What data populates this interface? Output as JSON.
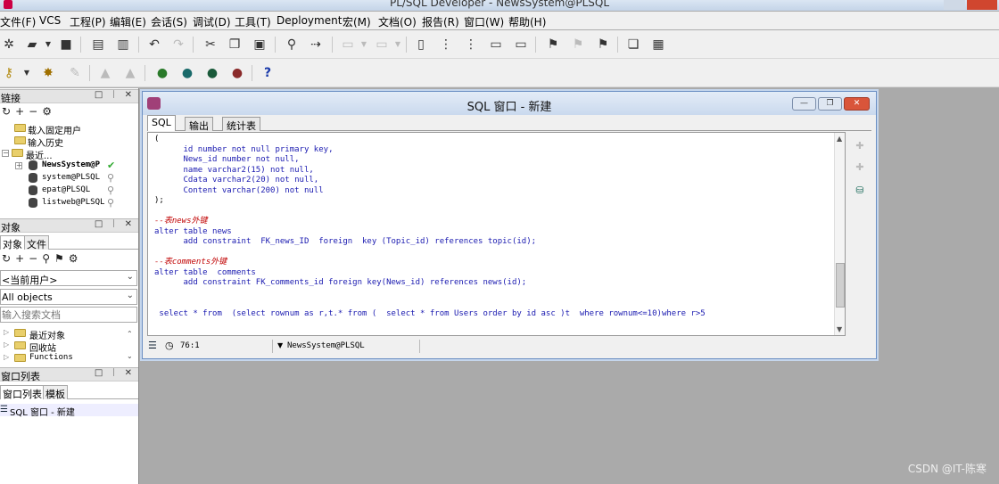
{
  "app": {
    "title": "PL/SQL Developer - NewsSystem@PLSQL"
  },
  "menu": [
    "文件(F)",
    "VCS",
    "工程(P)",
    "编辑(E)",
    "会话(S)",
    "调试(D)",
    "工具(T)",
    "Deployment",
    "宏(M)",
    "文档(O)",
    "报告(R)",
    "窗口(W)",
    "帮助(H)"
  ],
  "left": {
    "connections": {
      "title": "链接",
      "controls": "□ ᛁ ✕",
      "items": [
        {
          "label": "载入固定用户"
        },
        {
          "label": "输入历史"
        },
        {
          "label": "最近..."
        },
        {
          "label": "NewsSystem@P"
        },
        {
          "label": "system@PLSQL"
        },
        {
          "label": "epat@PLSQL"
        },
        {
          "label": "listweb@PLSQL"
        }
      ]
    },
    "objects": {
      "title": "对象",
      "controls": "□ ᛁ ✕",
      "tabs": [
        "对象",
        "文件"
      ],
      "owner": "<当前用户>",
      "filter": "All objects",
      "search_placeholder": "输入搜索文档",
      "items": [
        {
          "label": "最近对象"
        },
        {
          "label": "回收站"
        },
        {
          "label": "Functions"
        }
      ]
    },
    "windows": {
      "title": "窗口列表",
      "controls": "□ ᛁ ✕",
      "tabs": [
        "窗口列表",
        "模板"
      ],
      "items": [
        {
          "label": "SQL 窗口 - 新建"
        }
      ]
    }
  },
  "sql_window": {
    "title": "SQL 窗口 - 新建",
    "tabs": [
      "SQL",
      "输出",
      "统计表"
    ],
    "code": {
      "l1": "(",
      "l2": "      id number not null primary key,",
      "l3": "      News_id number not null,",
      "l4": "      name varchar2(15) not null,",
      "l5": "      Cdata varchar2(20) not null,",
      "l6": "      Content varchar(200) not null",
      "l7": ");",
      "l8": "--表news外键",
      "l9": "alter table news",
      "l10": "      add constraint  FK_news_ID  foreign  key (Topic_id) references topic(id);",
      "l11": "--表comments外键",
      "l12": "alter table  comments",
      "l13": "      add constraint FK_comments_id foreign key(News_id) references news(id);",
      "l14": " select * from  (select rownum as r,t.* from (  select * from Users order by id asc )t  where rownum<=10)where r>5"
    },
    "status": {
      "position": "76:1",
      "connection": "NewsSystem@PLSQL"
    }
  },
  "watermark": "CSDN @IT-陈寒"
}
